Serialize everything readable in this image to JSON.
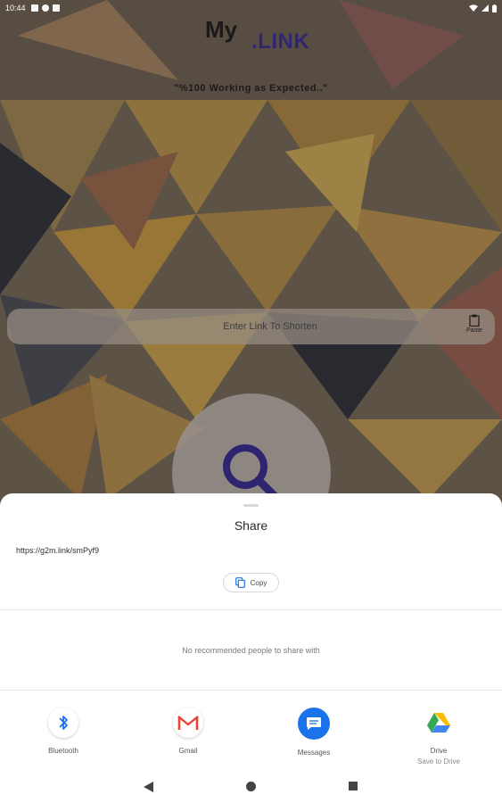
{
  "status_bar": {
    "time": "10:44"
  },
  "app": {
    "logo_my": "My",
    "logo_link": ".LINK",
    "tagline": "\"%100 Working as Expected..\"",
    "url_input": {
      "placeholder": "Enter Link To Shorten",
      "value": ""
    },
    "paste_label": "Paste",
    "search_button_icon": "search-icon"
  },
  "share_sheet": {
    "title": "Share",
    "url": "https://g2m.link/smPyf9",
    "copy_label": "Copy",
    "no_people_text": "No recommended people to share with",
    "targets": [
      {
        "name": "Bluetooth",
        "sub": "",
        "icon": "bluetooth-icon"
      },
      {
        "name": "Gmail",
        "sub": "",
        "icon": "gmail-icon"
      },
      {
        "name": "Messages",
        "sub": "",
        "icon": "messages-icon"
      },
      {
        "name": "Drive",
        "sub": "Save to Drive",
        "icon": "drive-icon"
      }
    ]
  },
  "colors": {
    "link_accent": "#2f2570",
    "bluetooth_blue": "#1a73e8",
    "messages_blue": "#1a73e8",
    "gmail_red": "#ea4335"
  }
}
